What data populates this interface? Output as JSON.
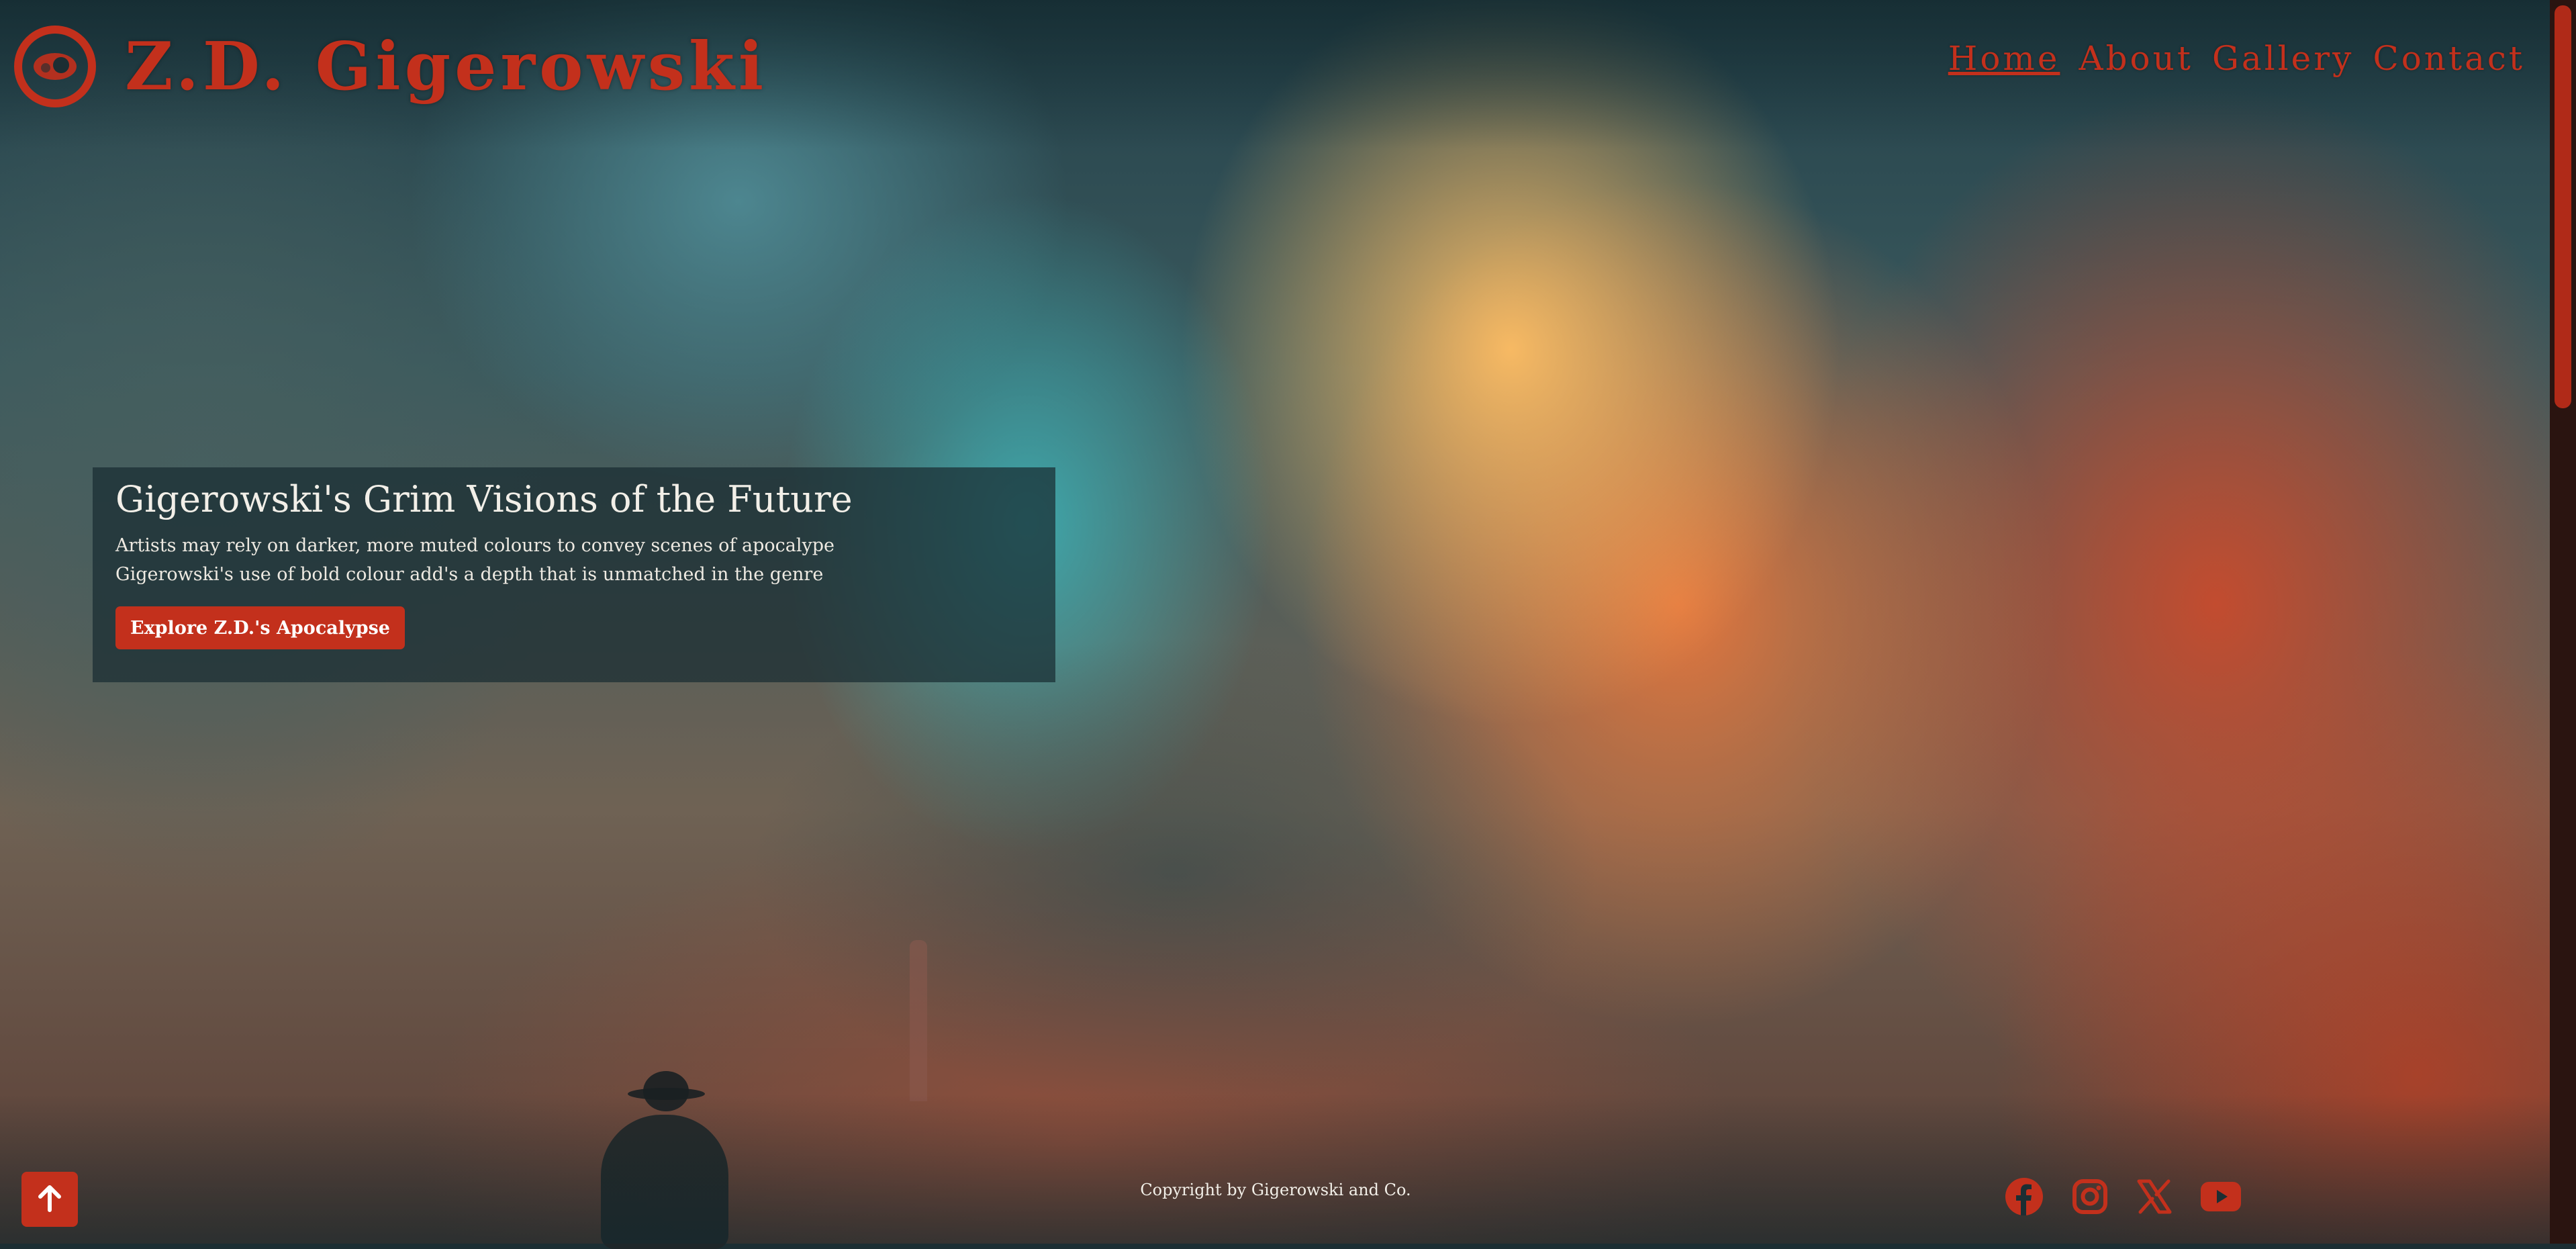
{
  "header": {
    "title": "Z.D. Gigerowski",
    "logo_icon": "eye-logo-icon",
    "nav": [
      {
        "label": "Home",
        "active": true
      },
      {
        "label": "About",
        "active": false
      },
      {
        "label": "Gallery",
        "active": false
      },
      {
        "label": "Contact",
        "active": false
      }
    ]
  },
  "hero": {
    "heading": "Gigerowski's Grim Visions of the Future",
    "line1": "Artists may rely on darker, more muted colours to convey scenes of apocalype",
    "line2": "Gigerowski's use of bold colour add's a depth that is unmatched in the genre",
    "cta_label": "Explore Z.D.'s Apocalypse"
  },
  "footer": {
    "copyright": "Copyright by Gigerowski and Co.",
    "back_to_top_icon": "arrow-up-icon",
    "social": [
      "facebook-icon",
      "instagram-icon",
      "x-icon",
      "youtube-icon"
    ]
  },
  "colors": {
    "accent": "#c3301c",
    "panel": "#192d32",
    "text_light": "#f2efe8"
  }
}
